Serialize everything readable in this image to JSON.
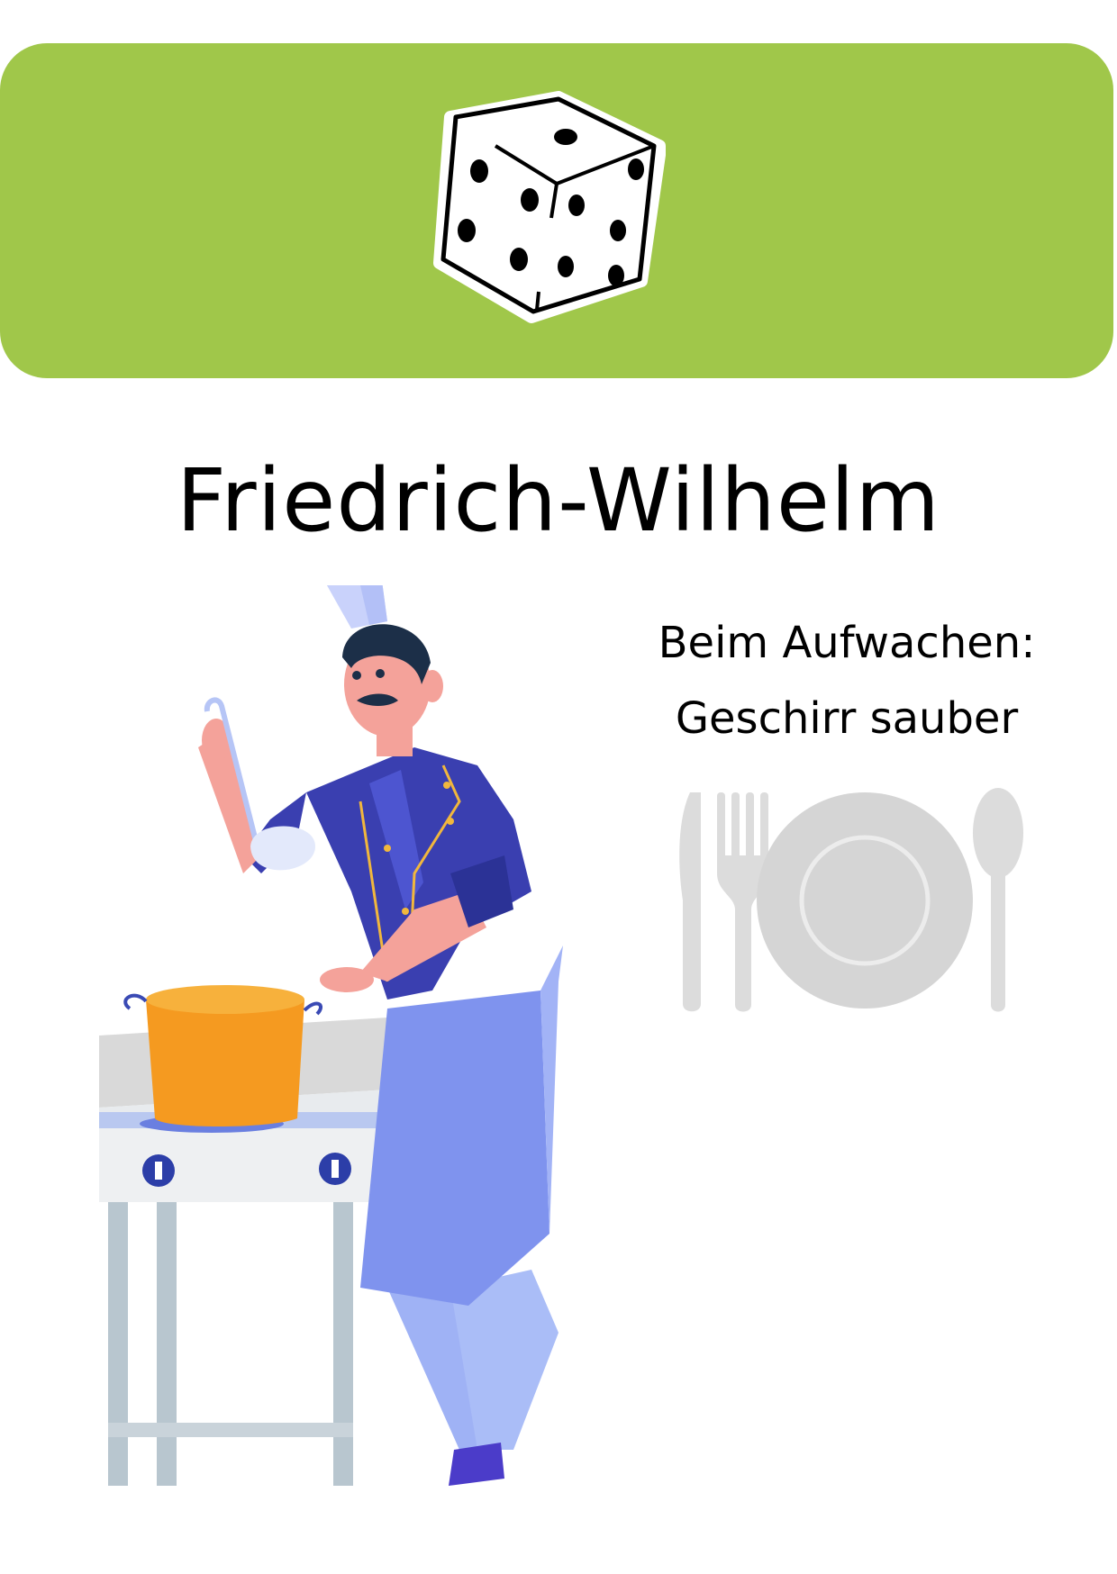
{
  "title": "Friedrich-Wilhelm",
  "subtitle": {
    "line1": "Beim Aufwachen:",
    "line2": "Geschirr sauber"
  },
  "colors": {
    "banner": "#a0c74a",
    "plate": "#d5d5d5",
    "chef_jacket": "#3a3fb0",
    "pot": "#f59a20"
  },
  "icons": {
    "banner_icon": "dice-icon",
    "tableware_icon": "plate-cutlery-icon",
    "illustration": "chef-cooking-illustration"
  }
}
